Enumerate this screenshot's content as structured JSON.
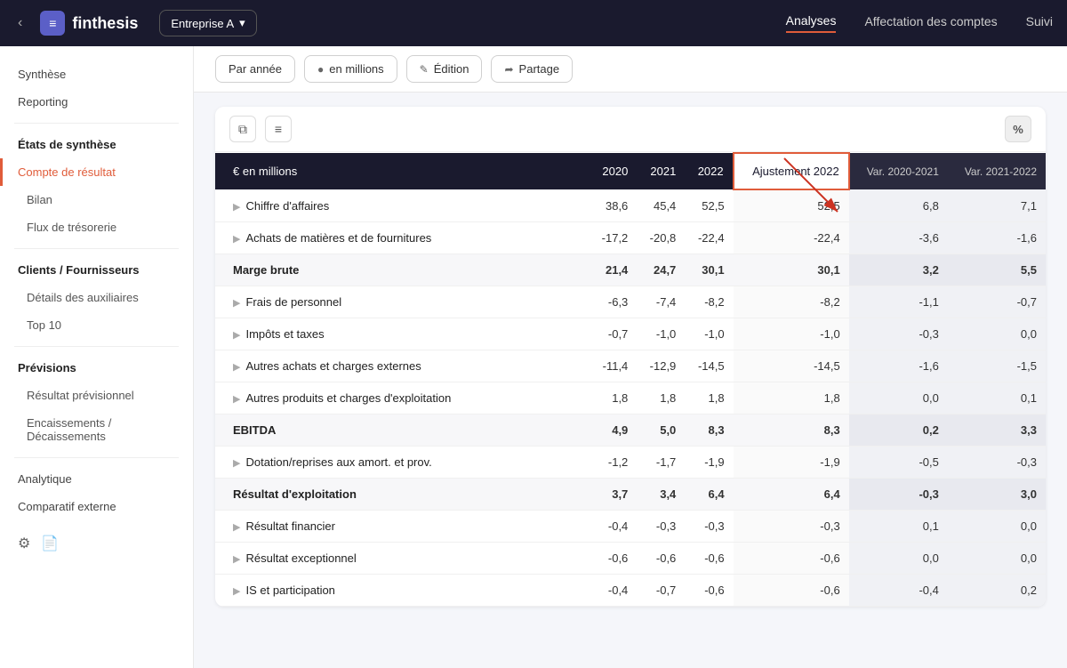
{
  "app": {
    "name": "finthesis",
    "logo_symbol": "≡"
  },
  "topnav": {
    "back_icon": "‹",
    "company": "Entreprise A",
    "chevron": "▾",
    "links": [
      {
        "label": "Analyses",
        "active": true
      },
      {
        "label": "Affectation des comptes",
        "active": false
      },
      {
        "label": "Suivi",
        "active": false
      }
    ]
  },
  "sidebar": {
    "items": [
      {
        "label": "Synthèse",
        "type": "top"
      },
      {
        "label": "Reporting",
        "type": "top"
      },
      {
        "label": "États de synthèse",
        "type": "section-header"
      },
      {
        "label": "Compte de résultat",
        "type": "active"
      },
      {
        "label": "Bilan",
        "type": "sub"
      },
      {
        "label": "Flux de trésorerie",
        "type": "sub"
      },
      {
        "label": "Clients / Fournisseurs",
        "type": "section-header"
      },
      {
        "label": "Détails des auxiliaires",
        "type": "sub"
      },
      {
        "label": "Top 10",
        "type": "sub"
      },
      {
        "label": "Prévisions",
        "type": "section-header"
      },
      {
        "label": "Résultat prévisionnel",
        "type": "sub"
      },
      {
        "label": "Encaissements / Décaissements",
        "type": "sub"
      },
      {
        "label": "Analytique",
        "type": "top"
      },
      {
        "label": "Comparatif externe",
        "type": "top"
      }
    ],
    "footer_icons": [
      "⚙",
      "📄"
    ]
  },
  "toolbar": {
    "buttons": [
      {
        "label": "Par année",
        "icon": ""
      },
      {
        "label": "en millions",
        "icon": "●"
      },
      {
        "label": "Édition",
        "icon": "✎"
      },
      {
        "label": "Partage",
        "icon": "➦"
      }
    ]
  },
  "table": {
    "copy_icon": "⧉",
    "sort_icon": "≡",
    "percent_label": "%",
    "header": {
      "row_label": "€ en millions",
      "col_2020": "2020",
      "col_2021": "2021",
      "col_2022": "2022",
      "col_ajust": "Ajustement 2022",
      "col_var1": "Var. 2020-2021",
      "col_var2": "Var. 2021-2022"
    },
    "rows": [
      {
        "label": "Chiffre d'affaires",
        "expandable": true,
        "bold": false,
        "v2020": "38,6",
        "v2021": "45,4",
        "v2022": "52,5",
        "ajust": "52,5",
        "var1": "6,8",
        "var2": "7,1"
      },
      {
        "label": "Achats de matières et de fournitures",
        "expandable": true,
        "bold": false,
        "v2020": "-17,2",
        "v2021": "-20,8",
        "v2022": "-22,4",
        "ajust": "-22,4",
        "var1": "-3,6",
        "var2": "-1,6"
      },
      {
        "label": "Marge brute",
        "expandable": false,
        "bold": true,
        "v2020": "21,4",
        "v2021": "24,7",
        "v2022": "30,1",
        "ajust": "30,1",
        "var1": "3,2",
        "var2": "5,5"
      },
      {
        "label": "Frais de personnel",
        "expandable": true,
        "bold": false,
        "v2020": "-6,3",
        "v2021": "-7,4",
        "v2022": "-8,2",
        "ajust": "-8,2",
        "var1": "-1,1",
        "var2": "-0,7"
      },
      {
        "label": "Impôts et taxes",
        "expandable": true,
        "bold": false,
        "v2020": "-0,7",
        "v2021": "-1,0",
        "v2022": "-1,0",
        "ajust": "-1,0",
        "var1": "-0,3",
        "var2": "0,0"
      },
      {
        "label": "Autres achats et charges externes",
        "expandable": true,
        "bold": false,
        "v2020": "-11,4",
        "v2021": "-12,9",
        "v2022": "-14,5",
        "ajust": "-14,5",
        "var1": "-1,6",
        "var2": "-1,5"
      },
      {
        "label": "Autres produits et charges d'exploitation",
        "expandable": true,
        "bold": false,
        "v2020": "1,8",
        "v2021": "1,8",
        "v2022": "1,8",
        "ajust": "1,8",
        "var1": "0,0",
        "var2": "0,1"
      },
      {
        "label": "EBITDA",
        "expandable": false,
        "bold": true,
        "v2020": "4,9",
        "v2021": "5,0",
        "v2022": "8,3",
        "ajust": "8,3",
        "var1": "0,2",
        "var2": "3,3"
      },
      {
        "label": "Dotation/reprises aux amort. et prov.",
        "expandable": true,
        "bold": false,
        "v2020": "-1,2",
        "v2021": "-1,7",
        "v2022": "-1,9",
        "ajust": "-1,9",
        "var1": "-0,5",
        "var2": "-0,3"
      },
      {
        "label": "Résultat d'exploitation",
        "expandable": false,
        "bold": true,
        "v2020": "3,7",
        "v2021": "3,4",
        "v2022": "6,4",
        "ajust": "6,4",
        "var1": "-0,3",
        "var2": "3,0"
      },
      {
        "label": "Résultat financier",
        "expandable": true,
        "bold": false,
        "v2020": "-0,4",
        "v2021": "-0,3",
        "v2022": "-0,3",
        "ajust": "-0,3",
        "var1": "0,1",
        "var2": "0,0"
      },
      {
        "label": "Résultat exceptionnel",
        "expandable": true,
        "bold": false,
        "v2020": "-0,6",
        "v2021": "-0,6",
        "v2022": "-0,6",
        "ajust": "-0,6",
        "var1": "0,0",
        "var2": "0,0"
      },
      {
        "label": "IS et participation",
        "expandable": true,
        "bold": false,
        "v2020": "-0,4",
        "v2021": "-0,7",
        "v2022": "-0,6",
        "ajust": "-0,6",
        "var1": "-0,4",
        "var2": "0,2"
      }
    ]
  }
}
